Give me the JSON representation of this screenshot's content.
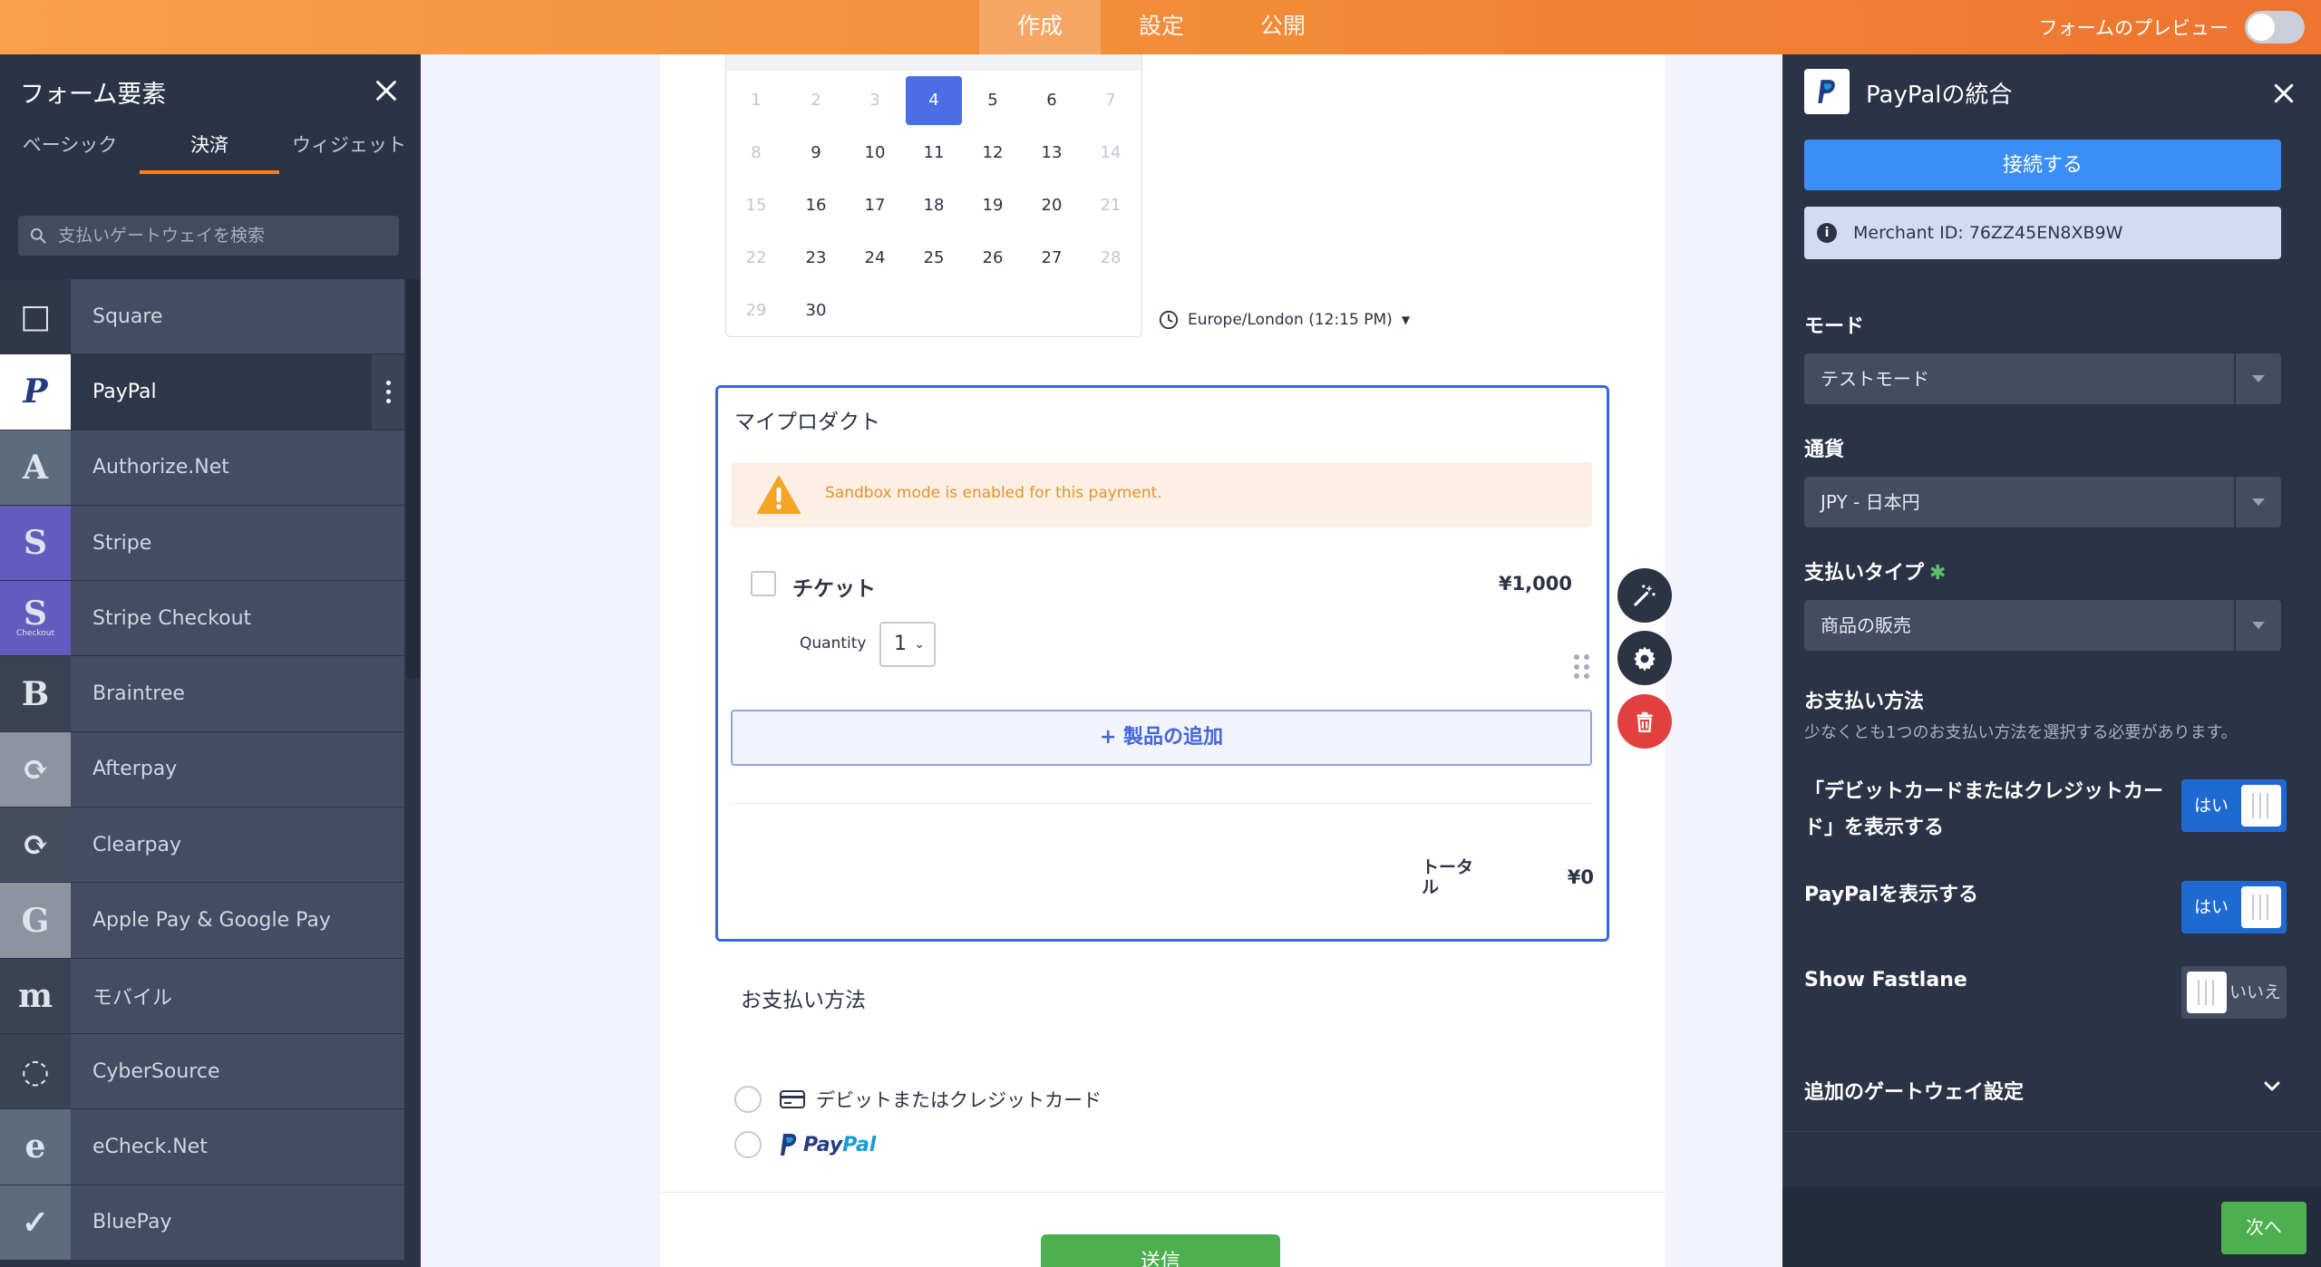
{
  "topbar": {
    "tabs": [
      {
        "label": "作成",
        "active": true
      },
      {
        "label": "設定",
        "active": false
      },
      {
        "label": "公開",
        "active": false
      }
    ],
    "preview_label": "フォームのプレビュー"
  },
  "left_panel": {
    "title": "フォーム要素",
    "tabs": [
      {
        "label": "ベーシック"
      },
      {
        "label": "決済"
      },
      {
        "label": "ウィジェット"
      }
    ],
    "search_placeholder": "支払いゲートウェイを検索",
    "gateways": [
      {
        "label": "Square",
        "icon": "square-logo-icon",
        "icon_bg": "#2f3749",
        "glyph": "□"
      },
      {
        "label": "PayPal",
        "icon": "paypal-logo-icon",
        "icon_bg": "#ffffff",
        "glyph": "P",
        "active": true
      },
      {
        "label": "Authorize.Net",
        "icon": "authorize-net-logo-icon",
        "icon_bg": "#5c6c7f",
        "glyph": "A"
      },
      {
        "label": "Stripe",
        "icon": "stripe-logo-icon",
        "icon_bg": "#635bbd",
        "glyph": "S"
      },
      {
        "label": "Stripe Checkout",
        "icon": "stripe-checkout-logo-icon",
        "icon_bg": "#635bbd",
        "glyph": "S",
        "sub": "Checkout"
      },
      {
        "label": "Braintree",
        "icon": "braintree-logo-icon",
        "icon_bg": "#3a4254",
        "glyph": "B"
      },
      {
        "label": "Afterpay",
        "icon": "afterpay-logo-icon",
        "icon_bg": "#8e949f",
        "glyph": "⟳"
      },
      {
        "label": "Clearpay",
        "icon": "clearpay-logo-icon",
        "icon_bg": "#454d5e",
        "glyph": "⟳"
      },
      {
        "label": "Apple Pay & Google Pay",
        "icon": "apple-google-pay-logo-icon",
        "icon_bg": "#8e949f",
        "glyph": "G"
      },
      {
        "label": "モバイル",
        "icon": "mollie-logo-icon",
        "icon_bg": "#3a4254",
        "glyph": "m"
      },
      {
        "label": "CyberSource",
        "icon": "cybersource-logo-icon",
        "icon_bg": "#3a4254",
        "glyph": "◌"
      },
      {
        "label": "eCheck.Net",
        "icon": "echeck-logo-icon",
        "icon_bg": "#5c6c7f",
        "glyph": "e"
      },
      {
        "label": "BluePay",
        "icon": "bluepay-logo-icon",
        "icon_bg": "#5c6c7f",
        "glyph": "✓"
      }
    ]
  },
  "calendar": {
    "rows": [
      [
        {
          "d": "1",
          "m": true
        },
        {
          "d": "2",
          "m": true
        },
        {
          "d": "3",
          "m": true
        },
        {
          "d": "4",
          "sel": true
        },
        {
          "d": "5"
        },
        {
          "d": "6"
        },
        {
          "d": "7",
          "m": true
        }
      ],
      [
        {
          "d": "8",
          "m": true
        },
        {
          "d": "9"
        },
        {
          "d": "10"
        },
        {
          "d": "11"
        },
        {
          "d": "12"
        },
        {
          "d": "13"
        },
        {
          "d": "14",
          "m": true
        }
      ],
      [
        {
          "d": "15",
          "m": true
        },
        {
          "d": "16"
        },
        {
          "d": "17"
        },
        {
          "d": "18"
        },
        {
          "d": "19"
        },
        {
          "d": "20"
        },
        {
          "d": "21",
          "m": true
        }
      ],
      [
        {
          "d": "22",
          "m": true
        },
        {
          "d": "23"
        },
        {
          "d": "24"
        },
        {
          "d": "25"
        },
        {
          "d": "26"
        },
        {
          "d": "27"
        },
        {
          "d": "28",
          "m": true
        }
      ],
      [
        {
          "d": "29",
          "m": true
        },
        {
          "d": "30"
        }
      ]
    ],
    "timezone": "Europe/London (12:15 PM)"
  },
  "product_widget": {
    "title": "マイプロダクト",
    "warning": "Sandbox mode is enabled for this payment.",
    "product_name": "チケット",
    "product_price": "¥1,000",
    "quantity_label": "Quantity",
    "quantity_value": "1",
    "add_product_label": "+ 製品の追加",
    "total_label": "トータル",
    "total_value": "¥0"
  },
  "payment_methods": {
    "title": "お支払い方法",
    "card_label": "デビットまたはクレジットカード",
    "paypal_part1": "Pay",
    "paypal_part2": "Pal"
  },
  "submit_label": "送信",
  "right_panel": {
    "title": "PayPalの統合",
    "connect_label": "接続する",
    "merchant_info": "Merchant ID: 76ZZ45EN8XB9W",
    "mode_label": "モード",
    "mode_value": "テストモード",
    "currency_label": "通貨",
    "currency_value": "JPY - 日本円",
    "payment_type_label": "支払いタイプ",
    "payment_type_value": "商品の販売",
    "payment_method_label": "お支払い方法",
    "payment_method_hint": "少なくとも1つのお支払い方法を選択する必要があります。",
    "show_card_label": "「デビットカードまたはクレジットカード」を表示する",
    "show_card_value": "はい",
    "show_paypal_label": "PayPalを表示する",
    "show_paypal_value": "はい",
    "show_fastlane_label": "Show Fastlane",
    "show_fastlane_value": "いいえ",
    "additional_settings_label": "追加のゲートウェイ設定",
    "next_label": "次へ"
  },
  "colors": {
    "accent_blue": "#3b8ef5",
    "brand_orange": "#f28a36",
    "success_green": "#4cb050",
    "danger_red": "#e0413f",
    "selected_blue": "#4b6ee6"
  }
}
